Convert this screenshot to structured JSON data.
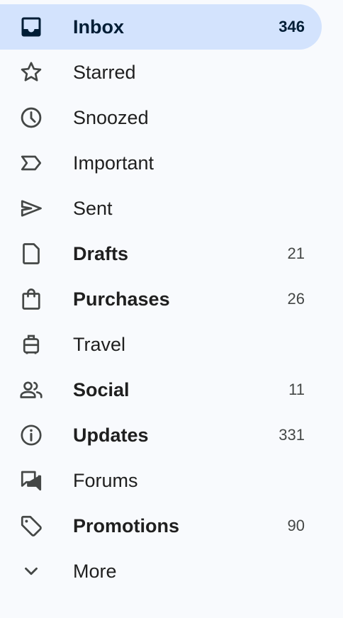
{
  "sidebar": {
    "items": [
      {
        "label": "Inbox",
        "count": "346",
        "icon": "inbox-icon"
      },
      {
        "label": "Starred",
        "count": "",
        "icon": "star-icon"
      },
      {
        "label": "Snoozed",
        "count": "",
        "icon": "clock-icon"
      },
      {
        "label": "Important",
        "count": "",
        "icon": "important-label-icon"
      },
      {
        "label": "Sent",
        "count": "",
        "icon": "send-icon"
      },
      {
        "label": "Drafts",
        "count": "21",
        "icon": "draft-file-icon"
      },
      {
        "label": "Purchases",
        "count": "26",
        "icon": "shopping-bag-icon"
      },
      {
        "label": "Travel",
        "count": "",
        "icon": "luggage-icon"
      },
      {
        "label": "Social",
        "count": "11",
        "icon": "people-icon"
      },
      {
        "label": "Updates",
        "count": "331",
        "icon": "info-icon"
      },
      {
        "label": "Forums",
        "count": "",
        "icon": "forum-icon"
      },
      {
        "label": "Promotions",
        "count": "90",
        "icon": "tag-icon"
      },
      {
        "label": "More",
        "count": "",
        "icon": "chevron-down-icon"
      }
    ]
  },
  "colors": {
    "background": "#f8fafd",
    "selected_background": "#d3e3fd",
    "selected_text": "#001d35",
    "text": "#1f1f1f",
    "icon": "#444746"
  }
}
